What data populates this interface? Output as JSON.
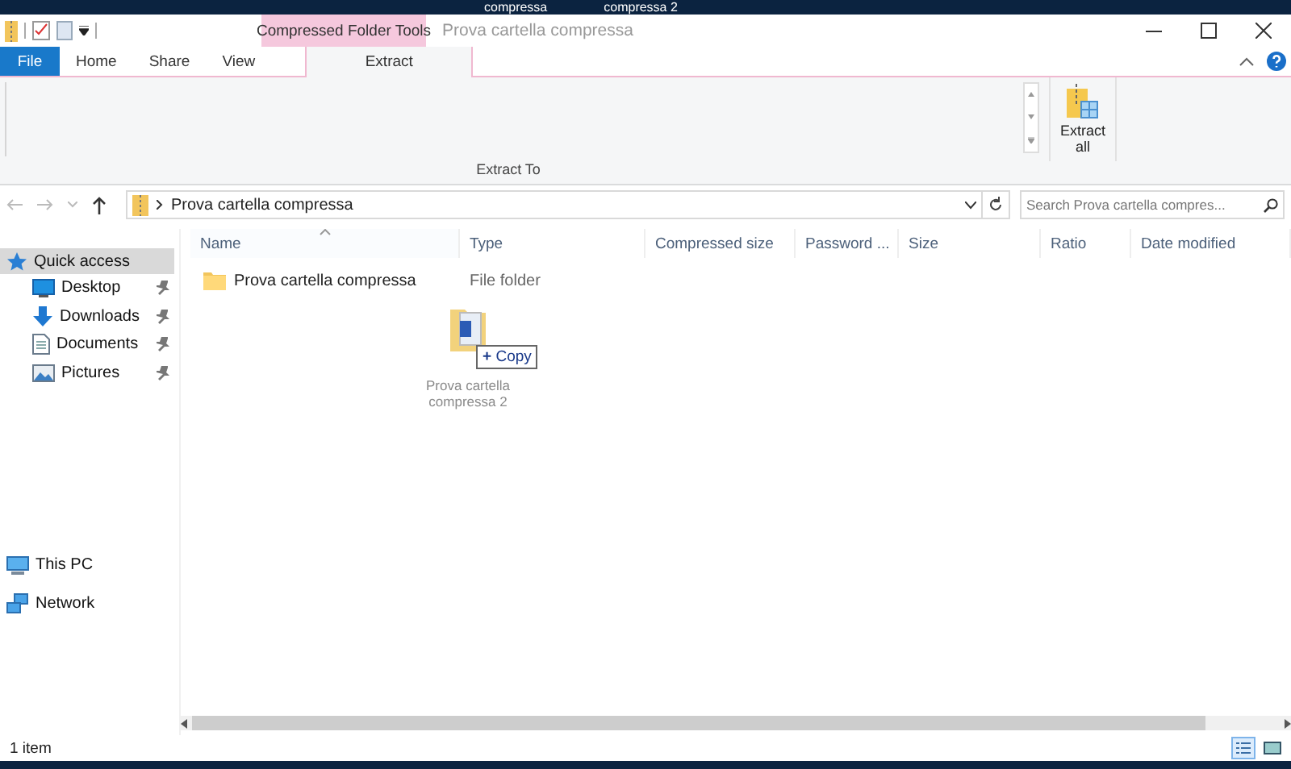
{
  "desktop_labels": [
    "compressa",
    "compressa 2"
  ],
  "window": {
    "title": "Prova cartella compressa",
    "context_group": "Compressed Folder Tools"
  },
  "tabs": [
    {
      "label": "File",
      "kind": "file",
      "selected": false
    },
    {
      "label": "Home",
      "kind": "tab",
      "selected": false
    },
    {
      "label": "Share",
      "kind": "tab",
      "selected": false
    },
    {
      "label": "View",
      "kind": "tab",
      "selected": false
    },
    {
      "label": "Extract",
      "kind": "context",
      "selected": true
    }
  ],
  "ribbon": {
    "group_label": "Extract To",
    "button": "Extract all"
  },
  "address": {
    "path": "Prova cartella compressa"
  },
  "search": {
    "placeholder": "Search Prova cartella compres..."
  },
  "sidebar": [
    {
      "label": "Quick access",
      "kind": "star",
      "selected": true,
      "pinned": false
    },
    {
      "label": "Desktop",
      "kind": "desktop",
      "selected": false,
      "pinned": true
    },
    {
      "label": "Downloads",
      "kind": "download",
      "selected": false,
      "pinned": true
    },
    {
      "label": "Documents",
      "kind": "document",
      "selected": false,
      "pinned": true
    },
    {
      "label": "Pictures",
      "kind": "picture",
      "selected": false,
      "pinned": true
    },
    {
      "label": "This PC",
      "kind": "pc",
      "selected": false,
      "pinned": false
    },
    {
      "label": "Network",
      "kind": "network",
      "selected": false,
      "pinned": false
    }
  ],
  "columns": [
    {
      "label": "Name",
      "sorted": true
    },
    {
      "label": "Type",
      "sorted": false
    },
    {
      "label": "Compressed size",
      "sorted": false
    },
    {
      "label": "Password ...",
      "sorted": false
    },
    {
      "label": "Size",
      "sorted": false
    },
    {
      "label": "Ratio",
      "sorted": false
    },
    {
      "label": "Date modified",
      "sorted": false
    }
  ],
  "rows": [
    {
      "name": "Prova cartella compressa",
      "type": "File folder"
    }
  ],
  "drag": {
    "label": "Prova cartella compressa 2",
    "symbol": "+",
    "action": "Copy"
  },
  "status": {
    "count": "1 item",
    "views": [
      {
        "kind": "details",
        "selected": true
      },
      {
        "kind": "large",
        "selected": false
      }
    ]
  }
}
